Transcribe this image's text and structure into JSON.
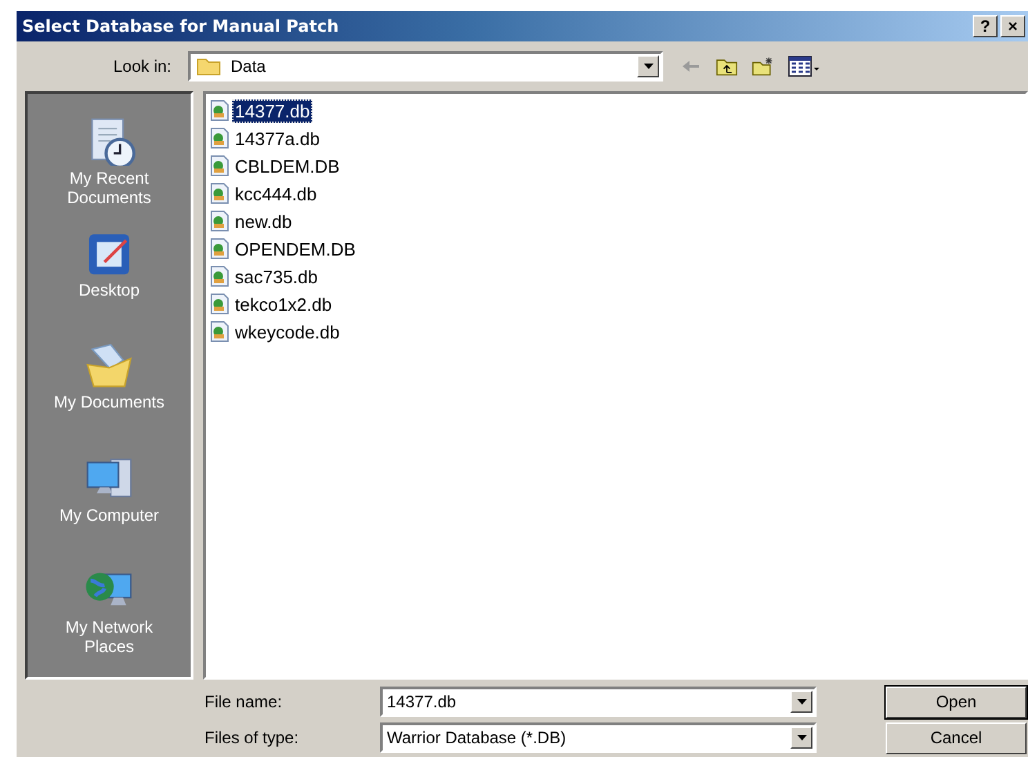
{
  "window": {
    "title": "Select Database for Manual Patch",
    "help_button": "?",
    "close_button": "×"
  },
  "look_in": {
    "label": "Look in:",
    "value": "Data"
  },
  "places": [
    {
      "label": "My Recent Documents",
      "kind": "recent"
    },
    {
      "label": "Desktop",
      "kind": "desktop"
    },
    {
      "label": "My Documents",
      "kind": "documents"
    },
    {
      "label": "My Computer",
      "kind": "computer"
    },
    {
      "label": "My Network Places",
      "kind": "network"
    }
  ],
  "files": [
    {
      "name": "14377.db",
      "selected": true
    },
    {
      "name": "14377a.db",
      "selected": false
    },
    {
      "name": "CBLDEM.DB",
      "selected": false
    },
    {
      "name": "kcc444.db",
      "selected": false
    },
    {
      "name": "new.db",
      "selected": false
    },
    {
      "name": "OPENDEM.DB",
      "selected": false
    },
    {
      "name": "sac735.db",
      "selected": false
    },
    {
      "name": "tekco1x2.db",
      "selected": false
    },
    {
      "name": "wkeycode.db",
      "selected": false
    }
  ],
  "file_name": {
    "label": "File name:",
    "value": "14377.db"
  },
  "file_type": {
    "label": "Files of type:",
    "value": "Warrior Database (*.DB)"
  },
  "buttons": [
    "Open",
    "Cancel"
  ]
}
